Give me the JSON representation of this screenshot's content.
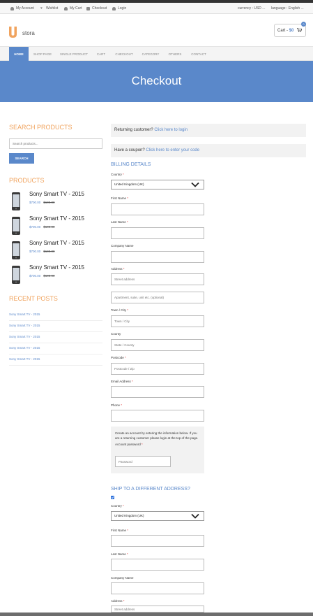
{
  "topbar": {
    "links": [
      "My Account",
      "Wishlist",
      "My Cart",
      "Checkout",
      "Login"
    ],
    "currency": "currency : USD ...",
    "language": "language : English ..."
  },
  "header": {
    "logo_letter": "U",
    "logo_text": "stora",
    "cart_label": "Cart - ",
    "cart_amount": "$0",
    "cart_count": "0"
  },
  "nav": {
    "items": [
      "Home",
      "Shop page",
      "Single product",
      "Cart",
      "Checkout",
      "Category",
      "Others",
      "Contact"
    ]
  },
  "banner": {
    "title": "Checkout"
  },
  "sidebar": {
    "search_heading": "Search Products",
    "search_placeholder": "Search products...",
    "search_button": "SEARCH",
    "products_heading": "Products",
    "products": [
      {
        "title": "Sony Smart TV - 2015",
        "price": "$700.00",
        "old_price": "$100.00"
      },
      {
        "title": "Sony Smart TV - 2015",
        "price": "$700.00",
        "old_price": "$100.00"
      },
      {
        "title": "Sony Smart TV - 2015",
        "price": "$700.00",
        "old_price": "$100.00"
      },
      {
        "title": "Sony Smart TV - 2015",
        "price": "$700.00",
        "old_price": "$100.00"
      }
    ],
    "recent_heading": "Recent Posts",
    "posts": [
      "Sony Smart TV - 2015",
      "Sony Smart TV - 2015",
      "Sony Smart TV - 2015",
      "Sony Smart TV - 2015",
      "Sony Smart TV - 2015"
    ]
  },
  "main": {
    "returning_text": "Returning customer?",
    "returning_link": "Click here to login",
    "coupon_text": "Have a coupon?",
    "coupon_link": "Click here to enter your code",
    "billing_heading": "Billing Details",
    "labels": {
      "country": "Country",
      "first_name": "First Name",
      "last_name": "Last Name",
      "company": "Company Name",
      "address": "Address",
      "town": "Town / City",
      "county": "County",
      "postcode": "Postcode",
      "email": "Email Address",
      "phone": "Phone",
      "password": "Account password"
    },
    "country_value": "United Kingdom (UK)",
    "placeholders": {
      "street": "Street address",
      "apartment": "Apartment, suite, unit etc. (optional)",
      "town": "Town / City",
      "county": "State / County",
      "postcode": "Postcode / Zip",
      "password": "Password"
    },
    "account_text": "Create an account by entering the information below. If you are a returning customer please login at the top of the page.",
    "ship_heading": "Ship to a different address?"
  },
  "colors": {
    "accent": "#5a88ca",
    "orange": "#f0a35e"
  }
}
